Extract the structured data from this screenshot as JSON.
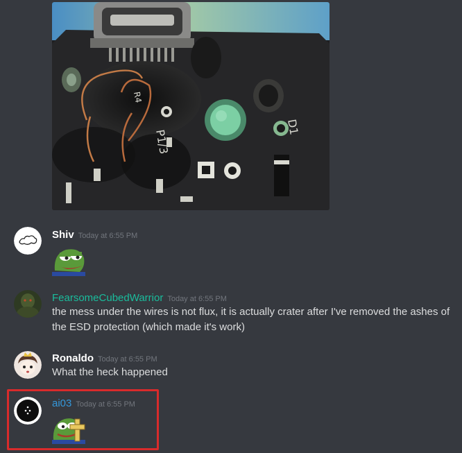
{
  "messages": [
    {
      "username": "Shiv",
      "timestamp": "Today at 6:55 PM",
      "name_color": "#ffffff",
      "emoji": "pepe-smug-emoji"
    },
    {
      "username": "FearsomeCubedWarrior",
      "timestamp": "Today at 6:55 PM",
      "name_color": "#1abc9c",
      "text": "the mess under the wires is not flux, it is actually crater after I've removed the ashes of the ESD protection (which made it's work)"
    },
    {
      "username": "Ronaldo",
      "timestamp": "Today at 6:55 PM",
      "name_color": "#ffffff",
      "text": "What the heck happened"
    },
    {
      "username": "ai03",
      "timestamp": "Today at 6:55 PM",
      "name_color": "#3498db",
      "emoji": "pepe-cross-emoji"
    }
  ],
  "colors": {
    "background": "#36393f",
    "text": "#dcddde",
    "timestamp": "#72767d",
    "highlight": "#d92b2b"
  }
}
